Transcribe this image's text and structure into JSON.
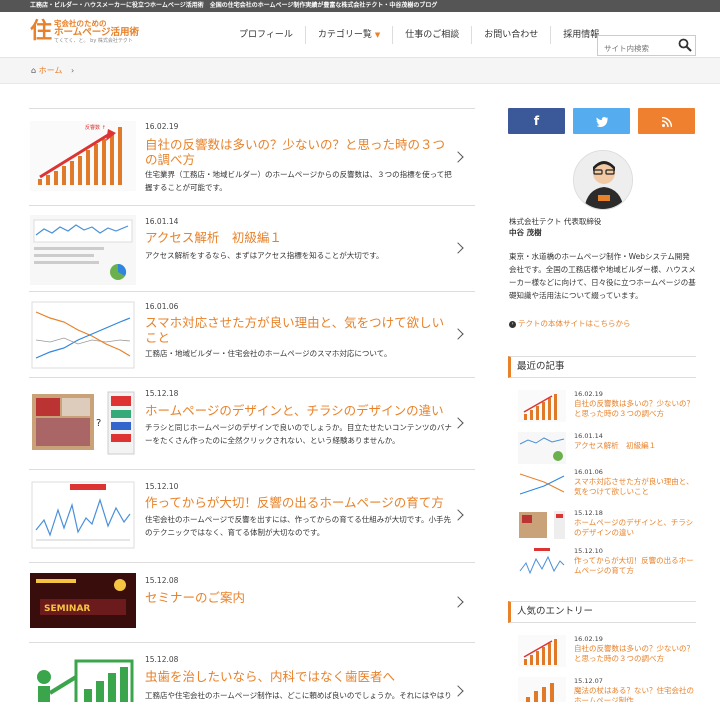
{
  "topbar": {
    "text": "工務店・ビルダー・ハウスメーカーに役立つホームページ活用術　全国の住宅会社のホームページ制作実績が豊富な株式会社テクト・中谷茂樹のブログ"
  },
  "logo": {
    "mark": "住",
    "line1": "宅会社のための",
    "line2": "ホームページ活用術",
    "line3": "てくてく、と。 by 株式会社テクト"
  },
  "nav": {
    "items": [
      "プロフィール",
      "カテゴリー覧",
      "仕事のご相談",
      "お問い合わせ",
      "採用情報"
    ]
  },
  "search": {
    "placeholder": "サイト内検索",
    "icon": "search-icon"
  },
  "breadcrumb": {
    "home": "ホーム",
    "sep": "›"
  },
  "posts": [
    {
      "date": "16.02.19",
      "title": "自社の反響数は多いの？少ないの？と思った時の３つの調べ方",
      "excerpt": "住宅業界（工務店・地域ビルダー）のホームページからの反響数は、３つの指標を使って把握することが可能です。"
    },
    {
      "date": "16.01.14",
      "title": "アクセス解析　初級編１",
      "excerpt": "アクセス解析をするなら、まずはアクセス指標を知ることが大切です。"
    },
    {
      "date": "16.01.06",
      "title": "スマホ対応させた方が良い理由と、気をつけて欲しいこと",
      "excerpt": "工務店・地域ビルダー・住宅会社のホームページのスマホ対応について。"
    },
    {
      "date": "15.12.18",
      "title": "ホームページのデザインと、チラシのデザインの違い",
      "excerpt": "チラシと同じホームページのデザインで良いのでしょうか。目立たせたいコンテンツのバナーをたくさん作ったのに全然クリックされない、という経験ありませんか。"
    },
    {
      "date": "15.12.10",
      "title": "作ってからが大切！反響の出るホームページの育て方",
      "excerpt": "住宅会社のホームページで反響を出すには、作ってからの育てる仕組みが大切です。小手先のテクニックではなく、育てる体制が大切なのです。"
    },
    {
      "date": "15.12.08",
      "title": "セミナーのご案内",
      "excerpt": ""
    },
    {
      "date": "15.12.08",
      "title": "虫歯を治したいなら、内科ではなく歯医者へ",
      "excerpt": "工務店や住宅会社のホームページ制作は、どこに頼めば良いのでしょうか。それにはやはり専門の業界知識や顧客心理を理解した専門の制作会社が必要です。"
    }
  ],
  "sidebar": {
    "sns": [
      "f",
      "t",
      "rss"
    ],
    "profile": {
      "company": "株式会社テクト 代表取締役",
      "name": "中谷 茂樹",
      "desc": "東京・水道橋のホームページ制作・Webシステム開発会社です。全国の工務店様や地域ビルダー様、ハウスメーカー様などに向けて、日々役に立つホームページの基礎知識や活用法について綴っています。",
      "link": "テクトの本体サイトはこちらから"
    },
    "recent_title": "最近の記事",
    "recent": [
      {
        "date": "16.02.19",
        "title": "自社の反響数は多いの？少ないの？と思った時の３つの調べ方"
      },
      {
        "date": "16.01.14",
        "title": "アクセス解析　初級編１"
      },
      {
        "date": "16.01.06",
        "title": "スマホ対応させた方が良い理由と、気をつけて欲しいこと"
      },
      {
        "date": "15.12.18",
        "title": "ホームページのデザインと、チラシのデザインの違い"
      },
      {
        "date": "15.12.10",
        "title": "作ってからが大切！反響の出るホームページの育て方"
      }
    ],
    "popular_title": "人気のエントリー",
    "popular": [
      {
        "date": "16.02.19",
        "title": "自社の反響数は多いの？少ないの？と思った時の３つの調べ方"
      },
      {
        "date": "15.12.07",
        "title": "魔法の杖はある？ない？住宅会社のホームページ制作"
      }
    ]
  },
  "colors": {
    "accent": "#e8822a",
    "facebook": "#3b5998",
    "twitter": "#55acee",
    "rss": "#ee802f"
  }
}
